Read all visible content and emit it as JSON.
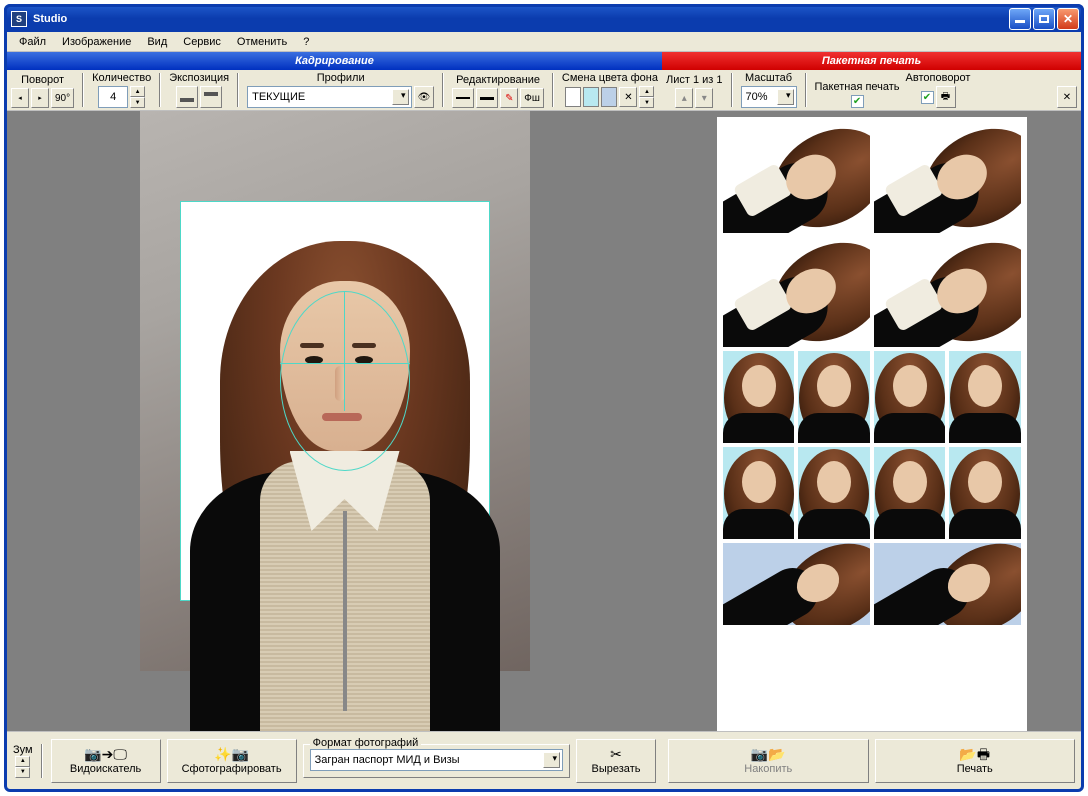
{
  "app": {
    "title": "Studio"
  },
  "menu": {
    "file": "Файл",
    "image": "Изображение",
    "view": "Вид",
    "service": "Сервис",
    "cancel": "Отменить",
    "help": "?"
  },
  "panelLeft": {
    "title": "Кадрирование",
    "groups": {
      "rotate": {
        "label": "Поворот",
        "deg": "90°"
      },
      "qty": {
        "label": "Количество",
        "value": "4"
      },
      "exposure": {
        "label": "Экспозиция"
      },
      "profiles": {
        "label": "Профили",
        "value": "ТЕКУЩИЕ"
      },
      "edit": {
        "label": "Редактирование",
        "fsh": "Фш"
      },
      "bgcolor": {
        "label": "Смена цвета фона"
      }
    }
  },
  "panelRight": {
    "title": "Пакетная печать",
    "sheet": {
      "label": "Лист 1 из 1"
    },
    "scale": {
      "label": "Масштаб",
      "value": "70%"
    },
    "batch": {
      "label": "Пакетная печать"
    },
    "autorotate": {
      "label": "Автоповорот"
    }
  },
  "bottom": {
    "zoom": "Зум",
    "viewfinder": "Видоискатель",
    "shoot": "Сфотографировать",
    "format_legend": "Формат фотографий",
    "format_value": "Загран паспорт МИД и Визы",
    "cut": "Вырезать",
    "accumulate": "Накопить",
    "print": "Печать"
  }
}
